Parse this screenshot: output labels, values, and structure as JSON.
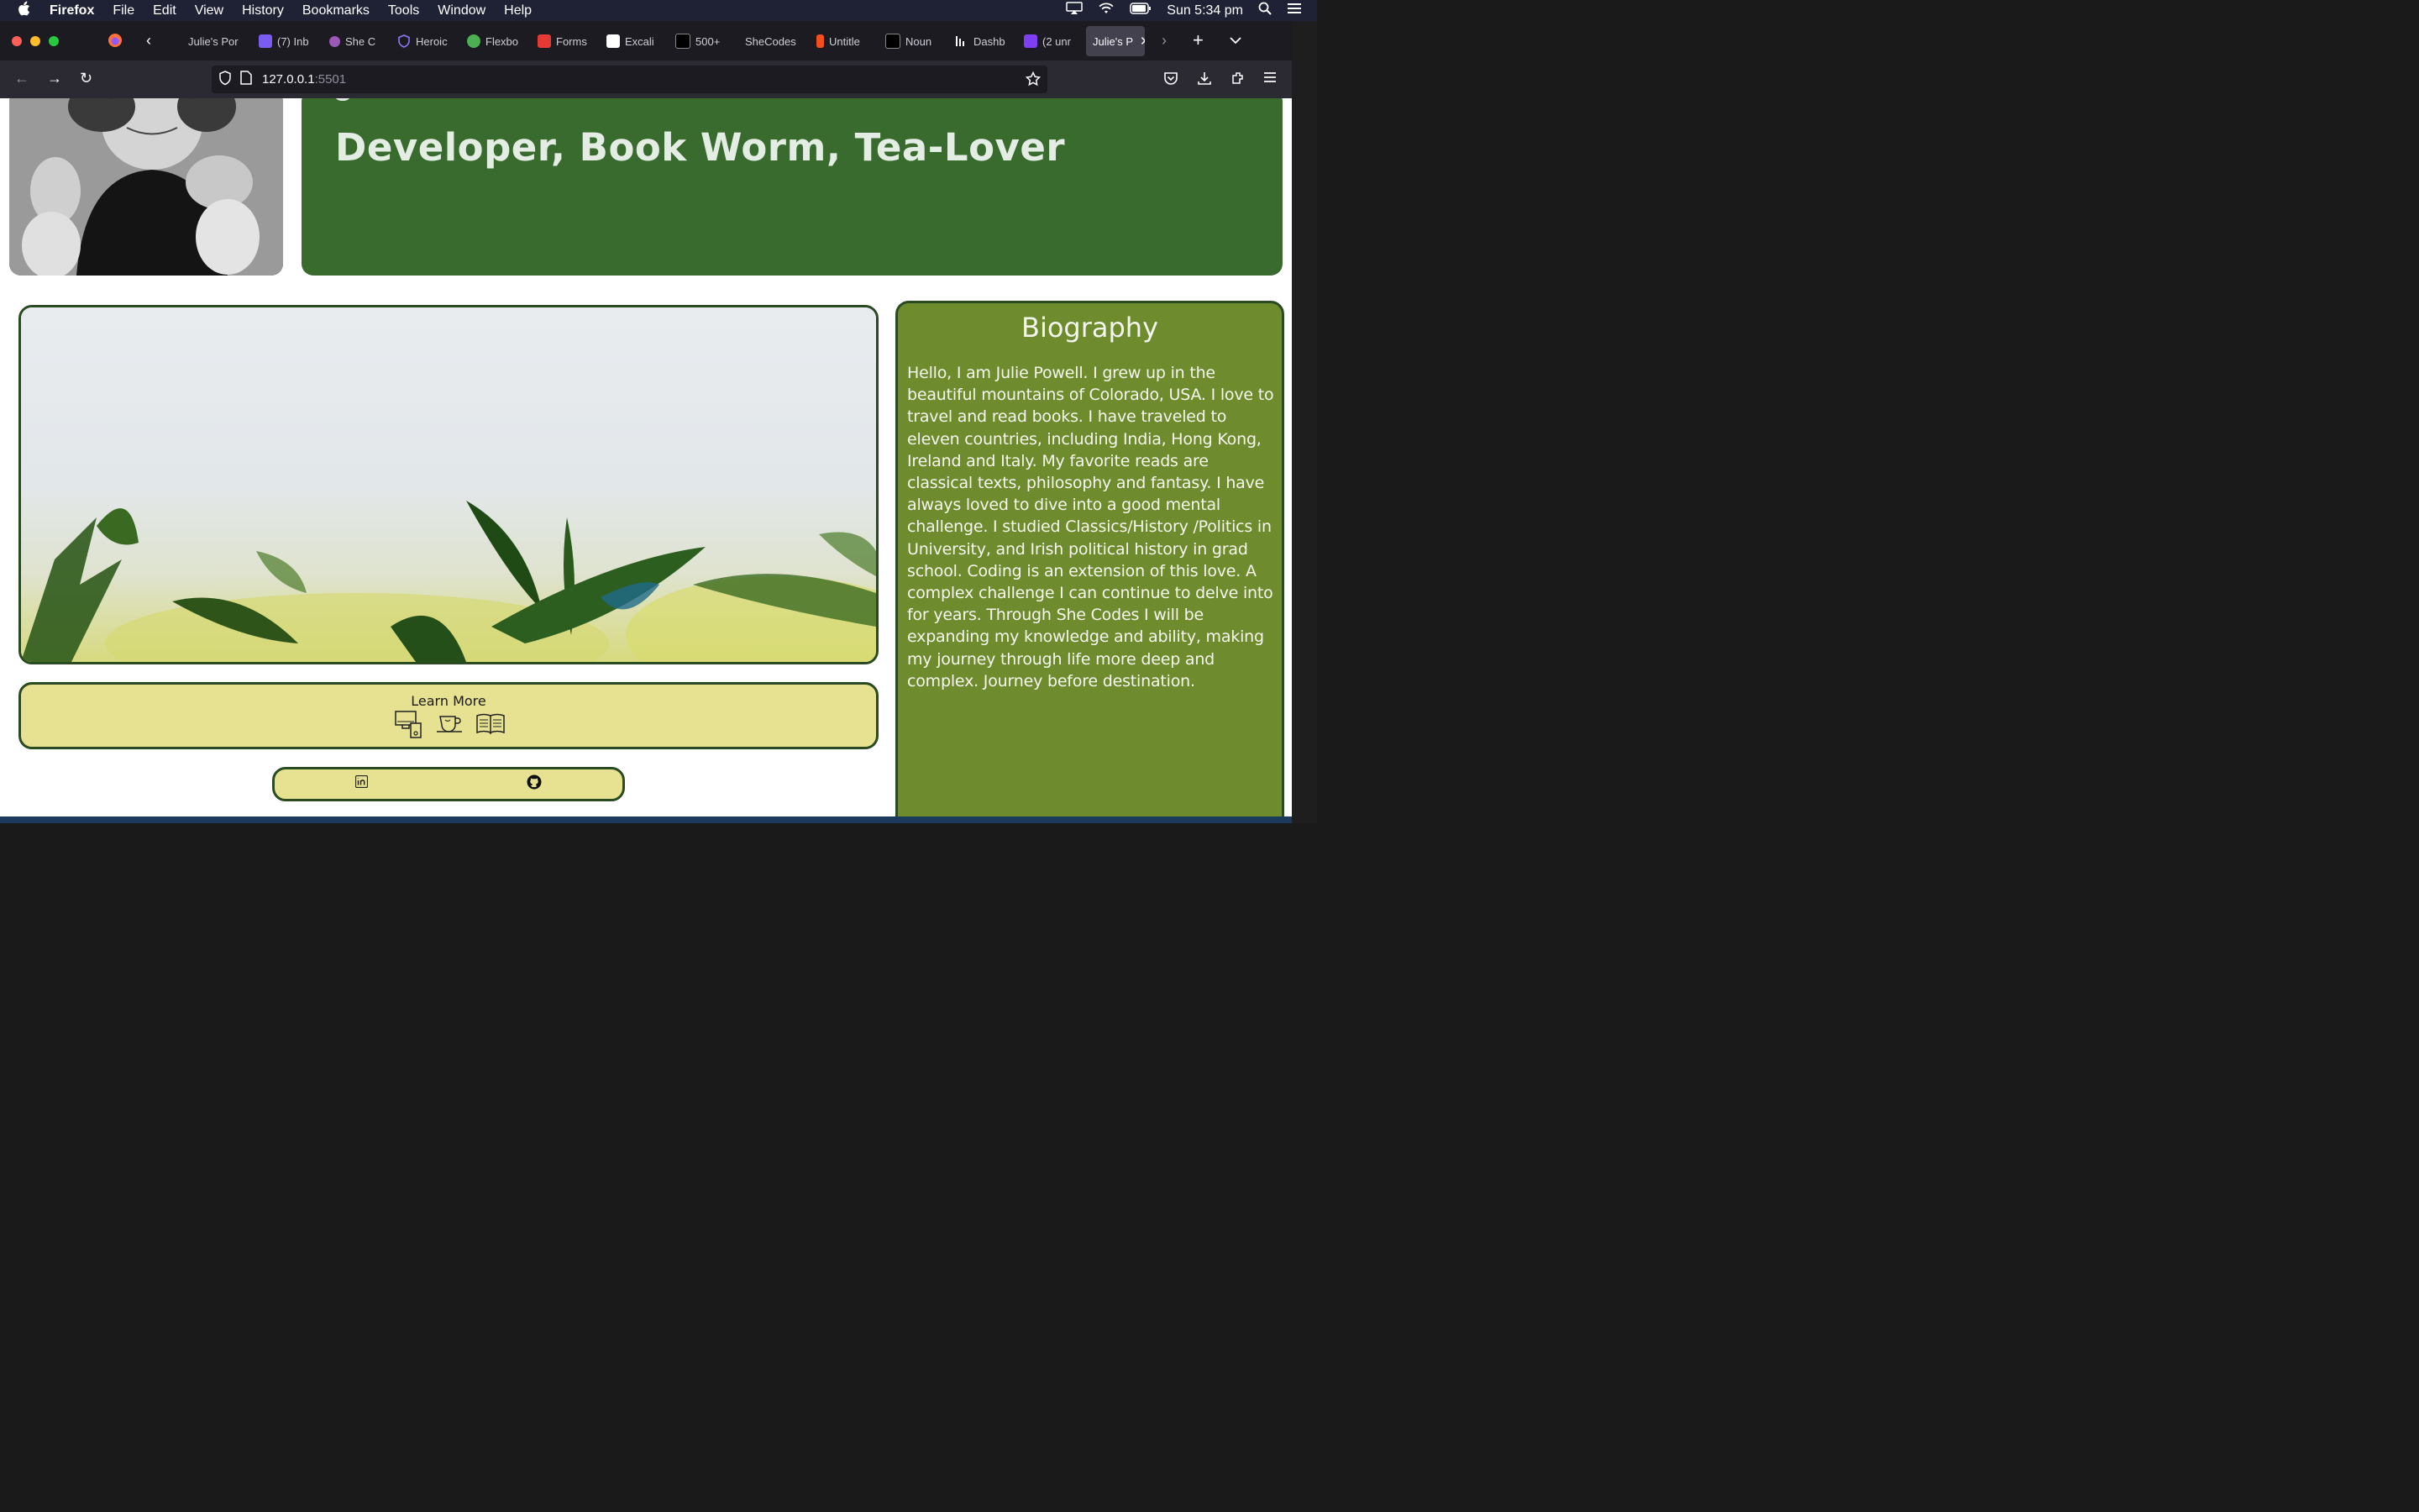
{
  "menubar": {
    "apple": "",
    "app_name": "Firefox",
    "menus": [
      "File",
      "Edit",
      "View",
      "History",
      "Bookmarks",
      "Tools",
      "Window",
      "Help"
    ],
    "clock": "Sun 5:34 pm"
  },
  "browser": {
    "tabs": [
      {
        "label": "Julie's Por",
        "icon": "page-icon",
        "color": "#2b2a33"
      },
      {
        "label": "(7) Inb",
        "icon": "mail-icon",
        "color": "#7b5cf0"
      },
      {
        "label": "She C",
        "icon": "shecodes-icon",
        "color": "#9b59b6"
      },
      {
        "label": "Heroic",
        "icon": "shield-icon",
        "color": "#8b7bf7"
      },
      {
        "label": "Flexbo",
        "icon": "frog-icon",
        "color": "#4caf50"
      },
      {
        "label": "Forms",
        "icon": "forms-icon",
        "color": "#e53935"
      },
      {
        "label": "Excali",
        "icon": "excalidraw-icon",
        "color": "#ffffff"
      },
      {
        "label": "500+",
        "icon": "fonts-icon",
        "color": "#000000"
      },
      {
        "label": "SheCodes",
        "icon": "",
        "color": ""
      },
      {
        "label": "Untitle",
        "icon": "figma-icon",
        "color": "#f24e1e"
      },
      {
        "label": "Noun",
        "icon": "noun-icon",
        "color": "#000000"
      },
      {
        "label": "Dashb",
        "icon": "dashboard-icon",
        "color": "#ffffff"
      },
      {
        "label": "(2 unr",
        "icon": "mail-icon",
        "color": "#7e3ff2"
      },
      {
        "label": "Julie's P",
        "icon": "",
        "color": ""
      }
    ],
    "url_host": "127.0.0.1",
    "url_port": ":5501"
  },
  "page": {
    "hero_subtitle": "Developer, Book Worm, Tea-Lover",
    "learn_more_title": "Learn More",
    "learn_icons": [
      "computer-icon",
      "teacup-icon",
      "open-book-icon"
    ],
    "social_icons": [
      "linkedin-icon",
      "github-icon"
    ],
    "bio_title": "Biography",
    "bio_text": "Hello, I am Julie Powell. I grew up in the beautiful mountains of Colorado, USA. I love to travel and read books. I have traveled to eleven countries, including India, Hong Kong, Ireland and Italy. My favorite reads are classical texts, philosophy and fantasy. I have always loved to dive into a good mental challenge. I studied Classics/History /Politics in University, and Irish political history in grad school. Coding is an extension of this love. A complex challenge I can continue to delve into for years. Through She Codes I will be expanding my knowledge and ability, making my journey through life more deep and complex. Journey before destination.",
    "colors": {
      "hero_green": "#386b2d",
      "bio_green": "#6e8c2d",
      "box_yellow": "#e7e291",
      "border_green": "#2a4a22"
    }
  }
}
